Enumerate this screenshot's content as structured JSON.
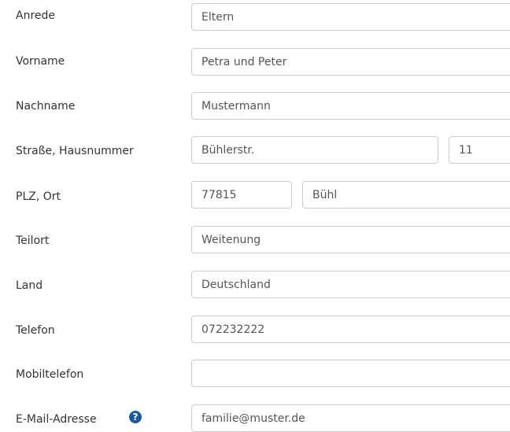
{
  "form": {
    "salutation": {
      "label": "Anrede",
      "value": "Eltern",
      "caret": "▼"
    },
    "first_name": {
      "label": "Vorname",
      "value": "Petra und Peter"
    },
    "last_name": {
      "label": "Nachname",
      "value": "Mustermann"
    },
    "street": {
      "label": "Straße, Hausnummer",
      "street_value": "Bühlerstr.",
      "number_value": "11"
    },
    "postal": {
      "label": "PLZ, Ort",
      "zip_value": "77815",
      "city_value": "Bühl"
    },
    "district": {
      "label": "Teilort",
      "value": "Weitenung"
    },
    "country": {
      "label": "Land",
      "value": "Deutschland",
      "caret": "▼"
    },
    "phone": {
      "label": "Telefon",
      "value": "072232222"
    },
    "mobile": {
      "label": "Mobiltelefon",
      "value": ""
    },
    "email": {
      "label": "E-Mail-Adresse",
      "value": "familie@muster.de",
      "help_icon": "question-circle-icon",
      "help_glyph": "?"
    }
  },
  "colors": {
    "border": "#cccccc",
    "label_text": "#333333",
    "input_text": "#555555",
    "help_icon": "#1a5a96"
  }
}
